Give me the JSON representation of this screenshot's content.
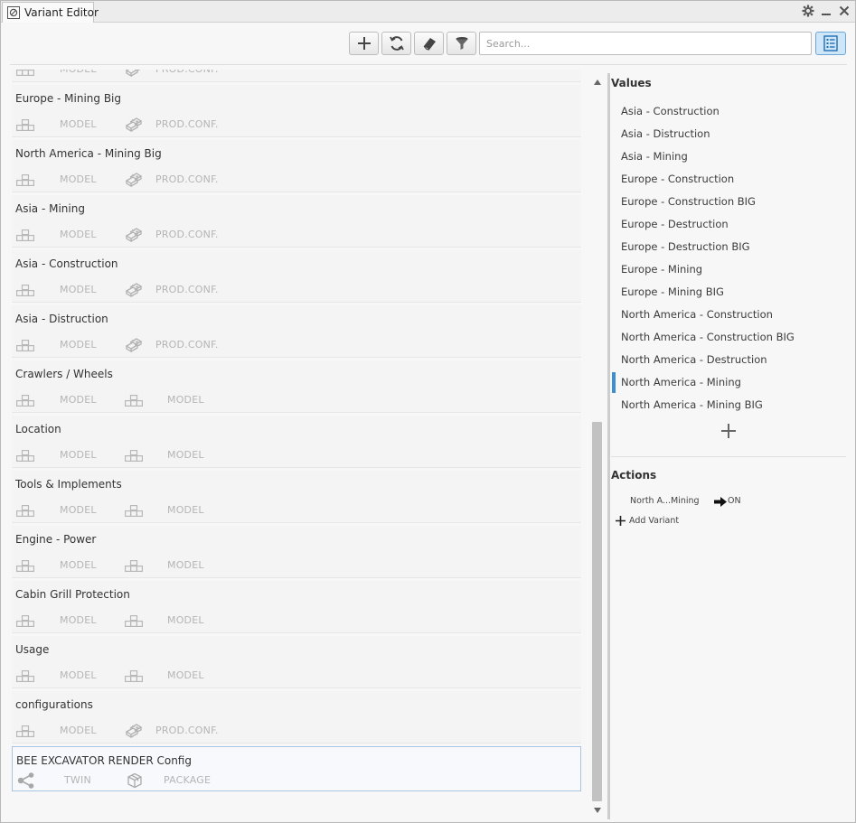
{
  "window": {
    "title": "Variant Editor"
  },
  "toolbar": {
    "buttons": [
      {
        "name": "add-button",
        "icon": "plus-icon"
      },
      {
        "name": "refresh-button",
        "icon": "refresh-icon"
      },
      {
        "name": "erase-button",
        "icon": "eraser-icon"
      },
      {
        "name": "filter-button",
        "icon": "filter-icon"
      }
    ],
    "search_placeholder": "Search...",
    "view_toggle_icon": "list-view-icon"
  },
  "variant_sets": [
    {
      "name": "",
      "left_label": "MODEL",
      "left_icon": "model-icon",
      "right_label": "PROD.CONF.",
      "right_icon": "product-configurator-icon"
    },
    {
      "name": "Europe - Mining Big",
      "left_label": "MODEL",
      "left_icon": "model-icon",
      "right_label": "PROD.CONF.",
      "right_icon": "product-configurator-icon"
    },
    {
      "name": "North America - Mining Big",
      "left_label": "MODEL",
      "left_icon": "model-icon",
      "right_label": "PROD.CONF.",
      "right_icon": "product-configurator-icon"
    },
    {
      "name": "Asia - Mining",
      "left_label": "MODEL",
      "left_icon": "model-icon",
      "right_label": "PROD.CONF.",
      "right_icon": "product-configurator-icon"
    },
    {
      "name": "Asia - Construction",
      "left_label": "MODEL",
      "left_icon": "model-icon",
      "right_label": "PROD.CONF.",
      "right_icon": "product-configurator-icon"
    },
    {
      "name": "Asia - Distruction",
      "left_label": "MODEL",
      "left_icon": "model-icon",
      "right_label": "PROD.CONF.",
      "right_icon": "product-configurator-icon"
    },
    {
      "name": "Crawlers / Wheels",
      "left_label": "MODEL",
      "left_icon": "model-icon",
      "right_label": "MODEL",
      "right_icon": "model-icon"
    },
    {
      "name": "Location",
      "left_label": "MODEL",
      "left_icon": "model-icon",
      "right_label": "MODEL",
      "right_icon": "model-icon"
    },
    {
      "name": "Tools & Implements",
      "left_label": "MODEL",
      "left_icon": "model-icon",
      "right_label": "MODEL",
      "right_icon": "model-icon"
    },
    {
      "name": "Engine  - Power",
      "left_label": "MODEL",
      "left_icon": "model-icon",
      "right_label": "MODEL",
      "right_icon": "model-icon"
    },
    {
      "name": "Cabin Grill Protection",
      "left_label": "MODEL",
      "left_icon": "model-icon",
      "right_label": "MODEL",
      "right_icon": "model-icon"
    },
    {
      "name": "Usage",
      "left_label": "MODEL",
      "left_icon": "model-icon",
      "right_label": "MODEL",
      "right_icon": "model-icon"
    },
    {
      "name": "configurations",
      "left_label": "MODEL",
      "left_icon": "model-icon",
      "right_label": "PROD.CONF.",
      "right_icon": "product-configurator-icon"
    },
    {
      "name": "BEE EXCAVATOR RENDER Config",
      "left_label": "TWIN",
      "left_icon": "share-node-icon",
      "right_label": "PACKAGE",
      "right_icon": "package-icon"
    }
  ],
  "values": {
    "title": "Values",
    "items": [
      "Asia - Construction",
      "Asia - Distruction",
      "Asia - Mining",
      "Europe - Construction",
      "Europe - Construction BIG",
      "Europe - Destruction",
      "Europe - Destruction BIG",
      "Europe - Mining",
      "Europe - Mining BIG",
      "North America - Construction",
      "North America - Construction BIG",
      "North America - Destruction",
      "North America - Mining",
      "North America - Mining BIG"
    ],
    "selected": "North America - Mining"
  },
  "actions": {
    "title": "Actions",
    "rows": [
      {
        "target": "North A...Mining",
        "state": "ON"
      }
    ],
    "add_label": "Add Variant"
  },
  "colors": {
    "accent": "#3f8fd0",
    "muted_text": "#b5b5b5"
  }
}
